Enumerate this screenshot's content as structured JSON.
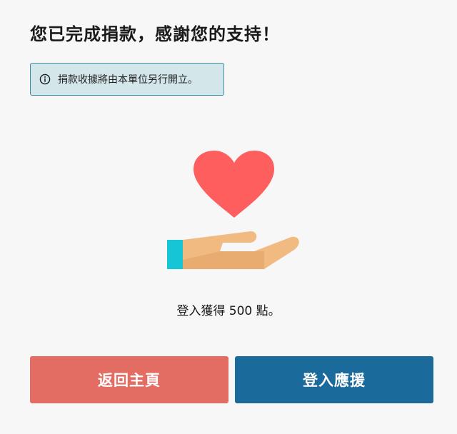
{
  "page": {
    "title": "您已完成捐款，感謝您的支持！"
  },
  "notice": {
    "text": "捐款收據將由本單位另行開立。",
    "icon": "info-icon"
  },
  "illustration": {
    "icons": [
      "heart-icon",
      "hand-icon"
    ],
    "colors": {
      "heart": "#ff5e5e",
      "hand": "#f0ba80",
      "cuff": "#17c6d6"
    }
  },
  "points": {
    "text": "登入獲得 500 點。"
  },
  "actions": {
    "home_label": "返回主頁",
    "login_label": "登入應援"
  },
  "colors": {
    "home_button": "#e46d63",
    "login_button": "#1a6a9b",
    "notice_bg": "#d3e6ea",
    "notice_border": "#3b8ca0"
  }
}
